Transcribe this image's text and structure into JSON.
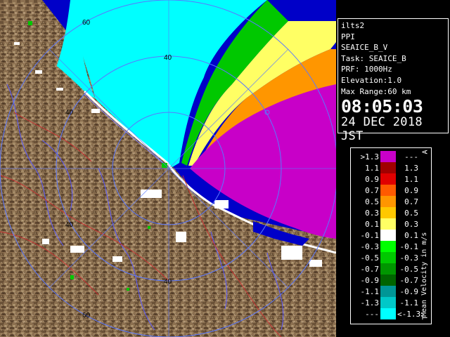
{
  "info": {
    "station": "ilts2",
    "mode": "PPI",
    "product": "SEAICE_B_V",
    "task": "Task: SEAICE_B",
    "prf": "PRF: 1000Hz",
    "elevation": "Elevation:1.0",
    "max_range": "Max Range:60 km",
    "time": "08:05:03",
    "date": "24 DEC 2018 JST"
  },
  "legend": {
    "title": "Mean Velocity in m/s",
    "top_mark": "A",
    "bottom_mark": "T",
    "rows": [
      {
        "lo": ">1.3",
        "hi": "---",
        "color": "#c800c8"
      },
      {
        "lo": "1.1",
        "hi": "1.3",
        "color": "#a00000"
      },
      {
        "lo": "0.9",
        "hi": "1.1",
        "color": "#e00000"
      },
      {
        "lo": "0.7",
        "hi": "0.9",
        "color": "#ff5a00"
      },
      {
        "lo": "0.5",
        "hi": "0.7",
        "color": "#ff9600"
      },
      {
        "lo": "0.3",
        "hi": "0.5",
        "color": "#ffc800"
      },
      {
        "lo": "0.1",
        "hi": "0.3",
        "color": "#ffff64"
      },
      {
        "lo": "-0.1",
        "hi": "0.1",
        "color": "#ffffff"
      },
      {
        "lo": "-0.3",
        "hi": "-0.1",
        "color": "#00ff00"
      },
      {
        "lo": "-0.5",
        "hi": "-0.3",
        "color": "#00c800"
      },
      {
        "lo": "-0.7",
        "hi": "-0.5",
        "color": "#009600"
      },
      {
        "lo": "-0.9",
        "hi": "-0.7",
        "color": "#006400"
      },
      {
        "lo": "-1.1",
        "hi": "-0.9",
        "color": "#009696"
      },
      {
        "lo": "-1.3",
        "hi": "-1.1",
        "color": "#00c8c8"
      },
      {
        "lo": "---",
        "hi": "<-1.3",
        "color": "#00ffff"
      }
    ]
  },
  "map": {
    "range_labels": [
      "60",
      "40",
      "40",
      "40",
      "40",
      "60"
    ],
    "colors": {
      "sea_inbound": "#00ffff",
      "sea_far": "#0000c8",
      "land": "#8c7050",
      "outbound": "#c800c8",
      "ring": "#5a78ff"
    }
  }
}
